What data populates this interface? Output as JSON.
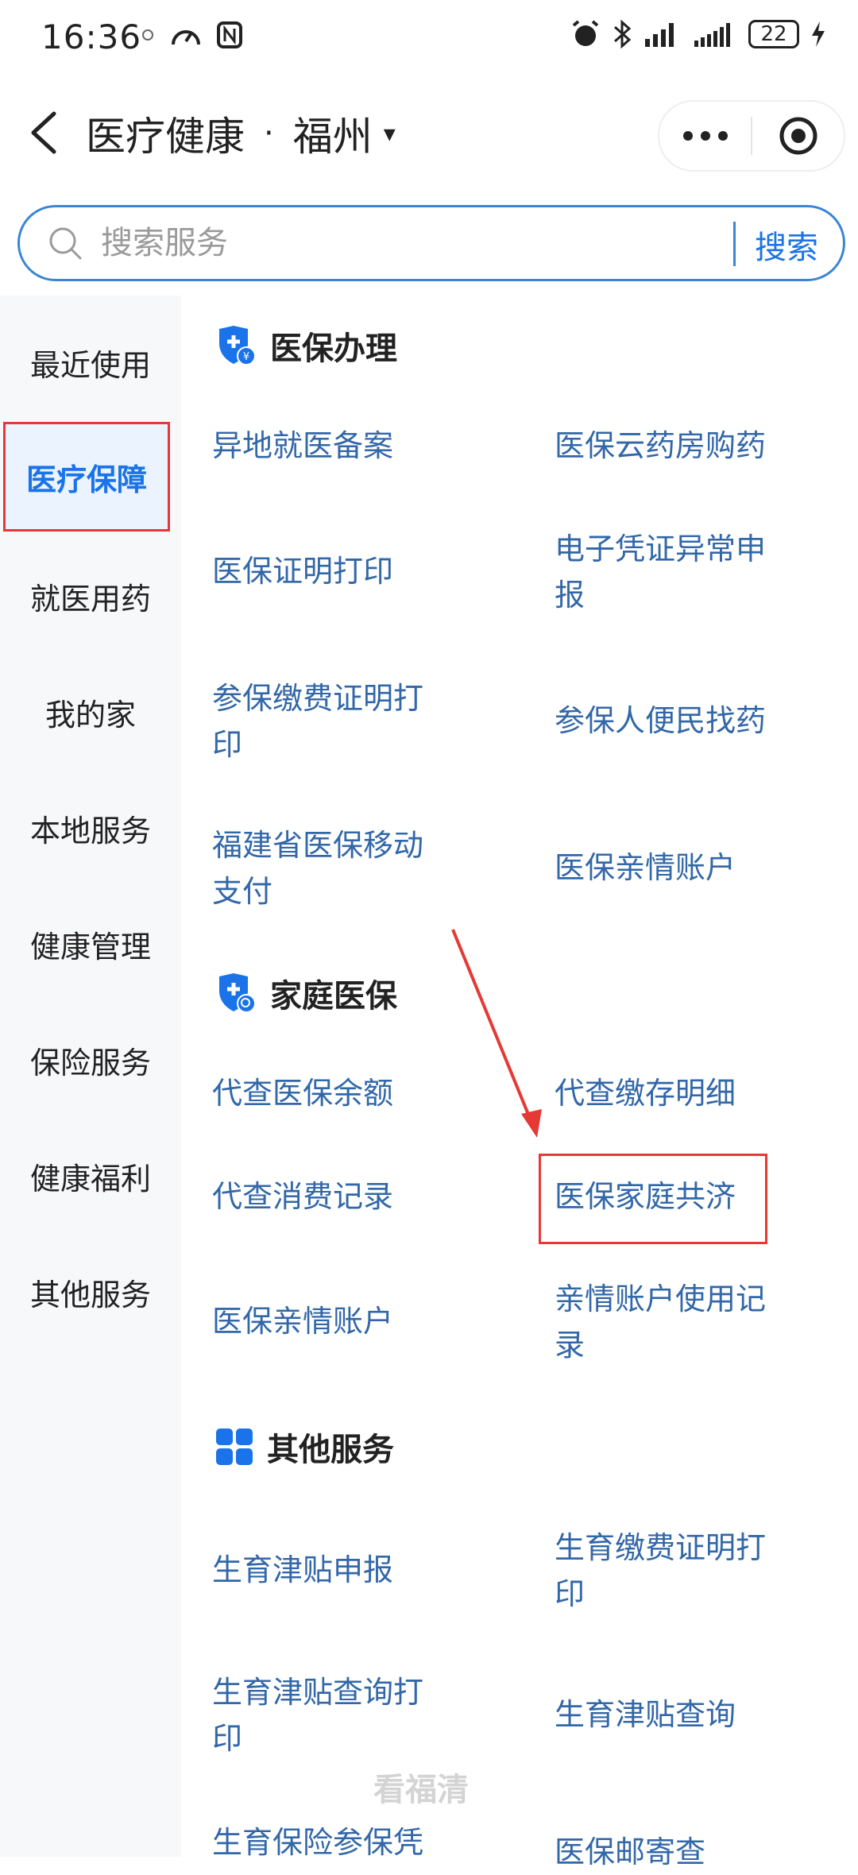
{
  "status_bar": {
    "time": "16:36",
    "battery": "22"
  },
  "nav": {
    "title": "医疗健康",
    "separator": "·",
    "city": "福州",
    "caret": "▾"
  },
  "search": {
    "placeholder": "搜索服务",
    "button": "搜索"
  },
  "sidebar": {
    "items": [
      {
        "label": "最近使用"
      },
      {
        "label": "医疗保障"
      },
      {
        "label": "就医用药"
      },
      {
        "label": "我的家"
      },
      {
        "label": "本地服务"
      },
      {
        "label": "健康管理"
      },
      {
        "label": "保险服务"
      },
      {
        "label": "健康福利"
      },
      {
        "label": "其他服务"
      }
    ]
  },
  "sections": {
    "medical_insurance": {
      "title": "医保办理",
      "items": [
        "异地就医备案",
        "医保云药房购药",
        "医保证明打印",
        "电子凭证异常申报",
        "参保缴费证明打印",
        "参保人便民找药",
        "福建省医保移动支付",
        "医保亲情账户"
      ]
    },
    "family_insurance": {
      "title": "家庭医保",
      "items": [
        "代查医保余额",
        "代查缴存明细",
        "代查消费记录",
        "医保家庭共济",
        "医保亲情账户",
        "亲情账户使用记录"
      ]
    },
    "other_services": {
      "title": "其他服务",
      "items": [
        "生育津贴申报",
        "生育缴费证明打印",
        "生育津贴查询打印",
        "生育津贴查询",
        "生育保险参保凭",
        "医保邮寄查"
      ]
    }
  },
  "watermark": "看福清",
  "colors": {
    "accent": "#1a73e8",
    "link": "#3267a8",
    "annotation": "#e53935",
    "sidebar_bg": "#f7f8fa"
  }
}
